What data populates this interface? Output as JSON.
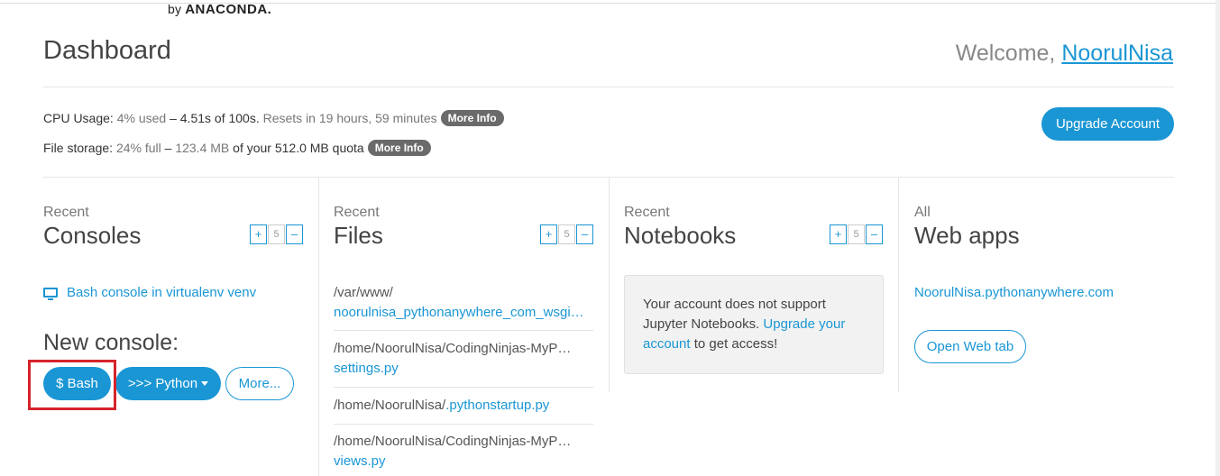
{
  "brand": {
    "by": "by",
    "name": "ANACONDA."
  },
  "header": {
    "title": "Dashboard",
    "welcome_prefix": "Welcome,",
    "username": "NoorulNisa"
  },
  "usage": {
    "cpu_label": "CPU Usage:",
    "cpu_used": "4% used",
    "cpu_dash": "–",
    "cpu_seconds": "4.51s of 100s.",
    "cpu_reset": "Resets in 19 hours, 59 minutes",
    "cpu_more": "More Info",
    "storage_label": "File storage:",
    "storage_used": "24% full",
    "storage_dash": "–",
    "storage_amount": "123.4 MB",
    "storage_quota": "of your 512.0 MB quota",
    "storage_more": "More Info",
    "upgrade_button": "Upgrade Account"
  },
  "consoles": {
    "small": "Recent",
    "title": "Consoles",
    "stepper": {
      "plus": "+",
      "count": "5",
      "minus": "–"
    },
    "recent_item": "Bash console in virtualenv venv",
    "new_console_label": "New console:",
    "bash_button": "$ Bash",
    "python_button": ">>> Python",
    "more_button": "More..."
  },
  "files": {
    "small": "Recent",
    "title": "Files",
    "stepper": {
      "plus": "+",
      "count": "5",
      "minus": "–"
    },
    "items": [
      {
        "path": "/var/www/",
        "name": "noorulnisa_pythonanywhere_com_wsgi…"
      },
      {
        "path": "/home/NoorulNisa/CodingNinjas-MyP…",
        "name": "settings.py"
      },
      {
        "path": "/home/NoorulNisa/",
        "name": ".pythonstartup.py"
      },
      {
        "path": "/home/NoorulNisa/CodingNinjas-MyP…",
        "name": "views.py"
      }
    ]
  },
  "notebooks": {
    "small": "Recent",
    "title": "Notebooks",
    "stepper": {
      "plus": "+",
      "count": "5",
      "minus": "–"
    },
    "message_part1": "Your account does not support Jupyter Notebooks.",
    "message_link": "Upgrade your account",
    "message_part2": "to get access!"
  },
  "webapps": {
    "small": "All",
    "title": "Web apps",
    "app_link": "NoorulNisa.pythonanywhere.com",
    "open_button": "Open Web tab"
  },
  "colors": {
    "accent": "#1a96d4",
    "pill": "#6a6a6a",
    "highlight": "#d6242b"
  }
}
